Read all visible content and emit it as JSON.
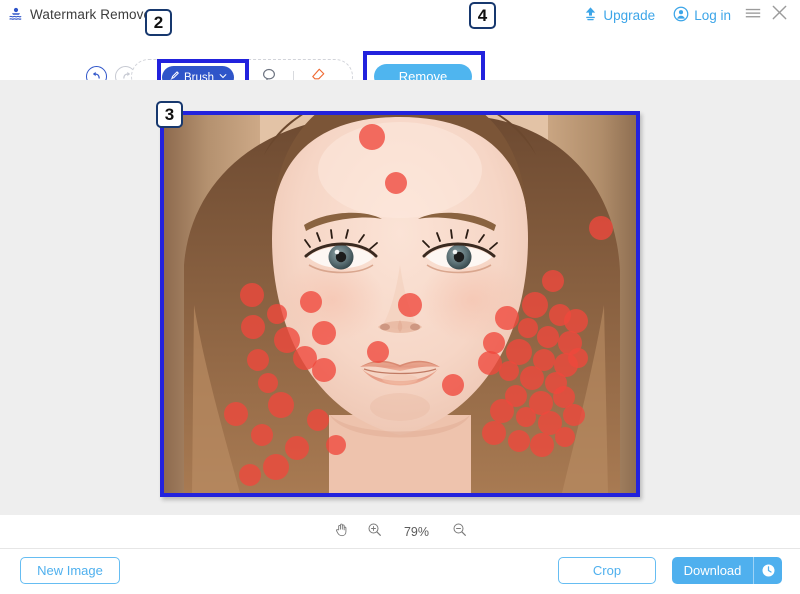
{
  "app": {
    "title": "Watermark Remover",
    "logo_icon": "watermark-logo-icon"
  },
  "header": {
    "upgrade_label": "Upgrade",
    "upgrade_icon": "upload-arrow-icon",
    "login_label": "Log in",
    "login_icon": "user-circle-icon",
    "menu_icon": "hamburger-menu-icon",
    "close_icon": "close-icon",
    "accent_color": "#3ca5e8"
  },
  "toolbar": {
    "undo_icon": "undo-arrow-icon",
    "redo_icon": "redo-arrow-icon",
    "brush_label": "Brush",
    "brush_icon": "brush-icon",
    "brush_caret_icon": "chevron-down-icon",
    "lasso_icon": "lasso-icon",
    "eraser_icon": "eraser-icon",
    "remove_label": "Remove",
    "brush_active_color": "#2f55c9",
    "remove_color": "#4fb5ef",
    "eraser_color": "#ef6b35"
  },
  "badges": [
    {
      "id": "badge-2",
      "label": "2"
    },
    {
      "id": "badge-3",
      "label": "3"
    },
    {
      "id": "badge-4",
      "label": "4"
    }
  ],
  "canvas": {
    "background_color": "#eeeeee",
    "selection_border_color": "#2222dd",
    "photo_alt": "portrait-photo-with-marked-blemishes",
    "mask_color": "#f0483c"
  },
  "zoombar": {
    "pan_icon": "hand-pan-icon",
    "zoom_in_icon": "zoom-in-icon",
    "zoom_level": "79%",
    "zoom_out_icon": "zoom-out-icon"
  },
  "footer": {
    "new_image_label": "New Image",
    "crop_label": "Crop",
    "download_label": "Download",
    "download_icon": "clock-icon",
    "accent_color": "#4fb0ee"
  },
  "mask_dots": [
    [
      208,
      22,
      13
    ],
    [
      232,
      68,
      11
    ],
    [
      88,
      180,
      12
    ],
    [
      147,
      187,
      11
    ],
    [
      113,
      199,
      10
    ],
    [
      89,
      212,
      12
    ],
    [
      123,
      225,
      13
    ],
    [
      160,
      218,
      12
    ],
    [
      94,
      245,
      11
    ],
    [
      141,
      243,
      12
    ],
    [
      104,
      268,
      10
    ],
    [
      117,
      290,
      13
    ],
    [
      72,
      299,
      12
    ],
    [
      154,
      305,
      11
    ],
    [
      98,
      320,
      11
    ],
    [
      133,
      333,
      12
    ],
    [
      172,
      330,
      10
    ],
    [
      112,
      352,
      13
    ],
    [
      86,
      360,
      11
    ],
    [
      437,
      113,
      12
    ],
    [
      389,
      166,
      11
    ],
    [
      371,
      190,
      13
    ],
    [
      396,
      200,
      11
    ],
    [
      412,
      206,
      12
    ],
    [
      343,
      203,
      12
    ],
    [
      364,
      213,
      10
    ],
    [
      384,
      222,
      11
    ],
    [
      406,
      228,
      12
    ],
    [
      330,
      228,
      11
    ],
    [
      355,
      237,
      13
    ],
    [
      380,
      245,
      11
    ],
    [
      402,
      250,
      12
    ],
    [
      345,
      256,
      10
    ],
    [
      368,
      263,
      12
    ],
    [
      392,
      268,
      11
    ],
    [
      326,
      248,
      12
    ],
    [
      414,
      243,
      10
    ],
    [
      352,
      281,
      11
    ],
    [
      377,
      288,
      12
    ],
    [
      400,
      282,
      11
    ],
    [
      338,
      296,
      12
    ],
    [
      362,
      302,
      10
    ],
    [
      386,
      308,
      12
    ],
    [
      410,
      300,
      11
    ],
    [
      330,
      318,
      12
    ],
    [
      355,
      326,
      11
    ],
    [
      378,
      330,
      12
    ],
    [
      401,
      322,
      10
    ],
    [
      214,
      237,
      11
    ],
    [
      160,
      255,
      12
    ],
    [
      246,
      190,
      12
    ],
    [
      289,
      270,
      11
    ]
  ]
}
